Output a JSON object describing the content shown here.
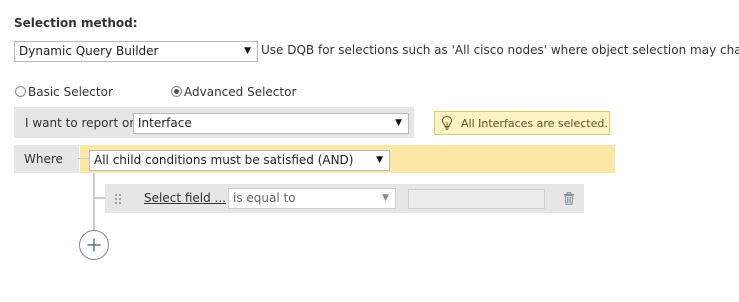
{
  "selection": {
    "title": "Selection method:",
    "method_value": "Dynamic Query Builder",
    "description": "Use DQB for selections such as 'All cisco nodes' where object selection may cha"
  },
  "selector_mode": {
    "basic_label": "Basic Selector",
    "advanced_label": "Advanced Selector",
    "selected": "Advanced Selector"
  },
  "report": {
    "label": "I want to report on",
    "value": "Interface",
    "info": "All Interfaces are selected.",
    "info_icon": "lightbulb-icon"
  },
  "where": {
    "label": "Where",
    "condition_value": "All child conditions must be satisfied (AND)"
  },
  "rule": {
    "drag_icon": "drag-handle-icon",
    "field_link": "Select field ...",
    "operator_value": "is equal to",
    "value": "",
    "delete_icon": "trash-icon"
  },
  "add_icon": "plus-circle-icon",
  "colors": {
    "condition_bg": "#fde7a6",
    "info_bg": "#fdf3c4",
    "panel_bg": "#e6e6e6"
  }
}
